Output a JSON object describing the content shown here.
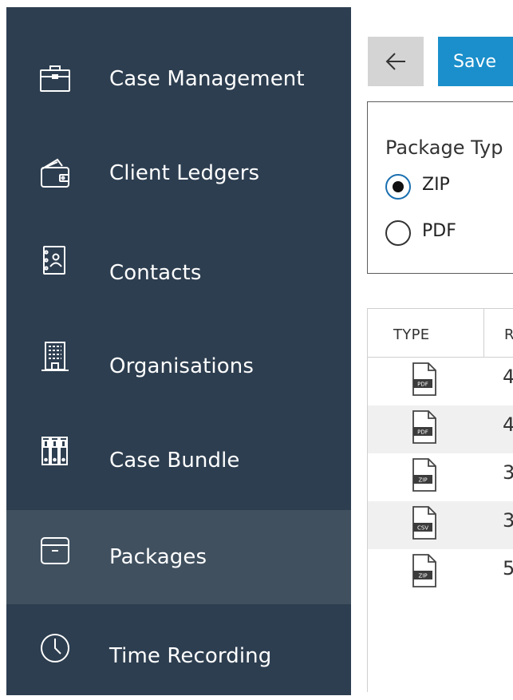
{
  "sidebar": {
    "items": [
      {
        "label": "Case Management",
        "icon": "briefcase-icon",
        "active": false
      },
      {
        "label": "Client Ledgers",
        "icon": "wallet-icon",
        "active": false
      },
      {
        "label": "Contacts",
        "icon": "contact-book-icon",
        "active": false
      },
      {
        "label": "Organisations",
        "icon": "building-icon",
        "active": false
      },
      {
        "label": "Case Bundle",
        "icon": "binders-icon",
        "active": false
      },
      {
        "label": "Packages",
        "icon": "archive-box-icon",
        "active": true
      },
      {
        "label": "Time Recording",
        "icon": "clock-icon",
        "active": false
      }
    ]
  },
  "toolbar": {
    "back_icon": "arrow-left-icon",
    "save_label": "Save"
  },
  "package_type": {
    "title": "Package Typ",
    "options": [
      {
        "label": "ZIP",
        "checked": true
      },
      {
        "label": "PDF",
        "checked": false
      }
    ]
  },
  "grid": {
    "columns": [
      "TYPE",
      "R"
    ],
    "rows": [
      {
        "file_type": "PDF",
        "value": "4"
      },
      {
        "file_type": "PDF",
        "value": "4"
      },
      {
        "file_type": "ZIP",
        "value": "3"
      },
      {
        "file_type": "CSV",
        "value": "3"
      },
      {
        "file_type": "ZIP",
        "value": "5"
      }
    ]
  },
  "colors": {
    "sidebar_bg": "#2d3e50",
    "sidebar_active": "#40505f",
    "accent": "#1a8fcb",
    "back_button_bg": "#d4d4d4"
  }
}
